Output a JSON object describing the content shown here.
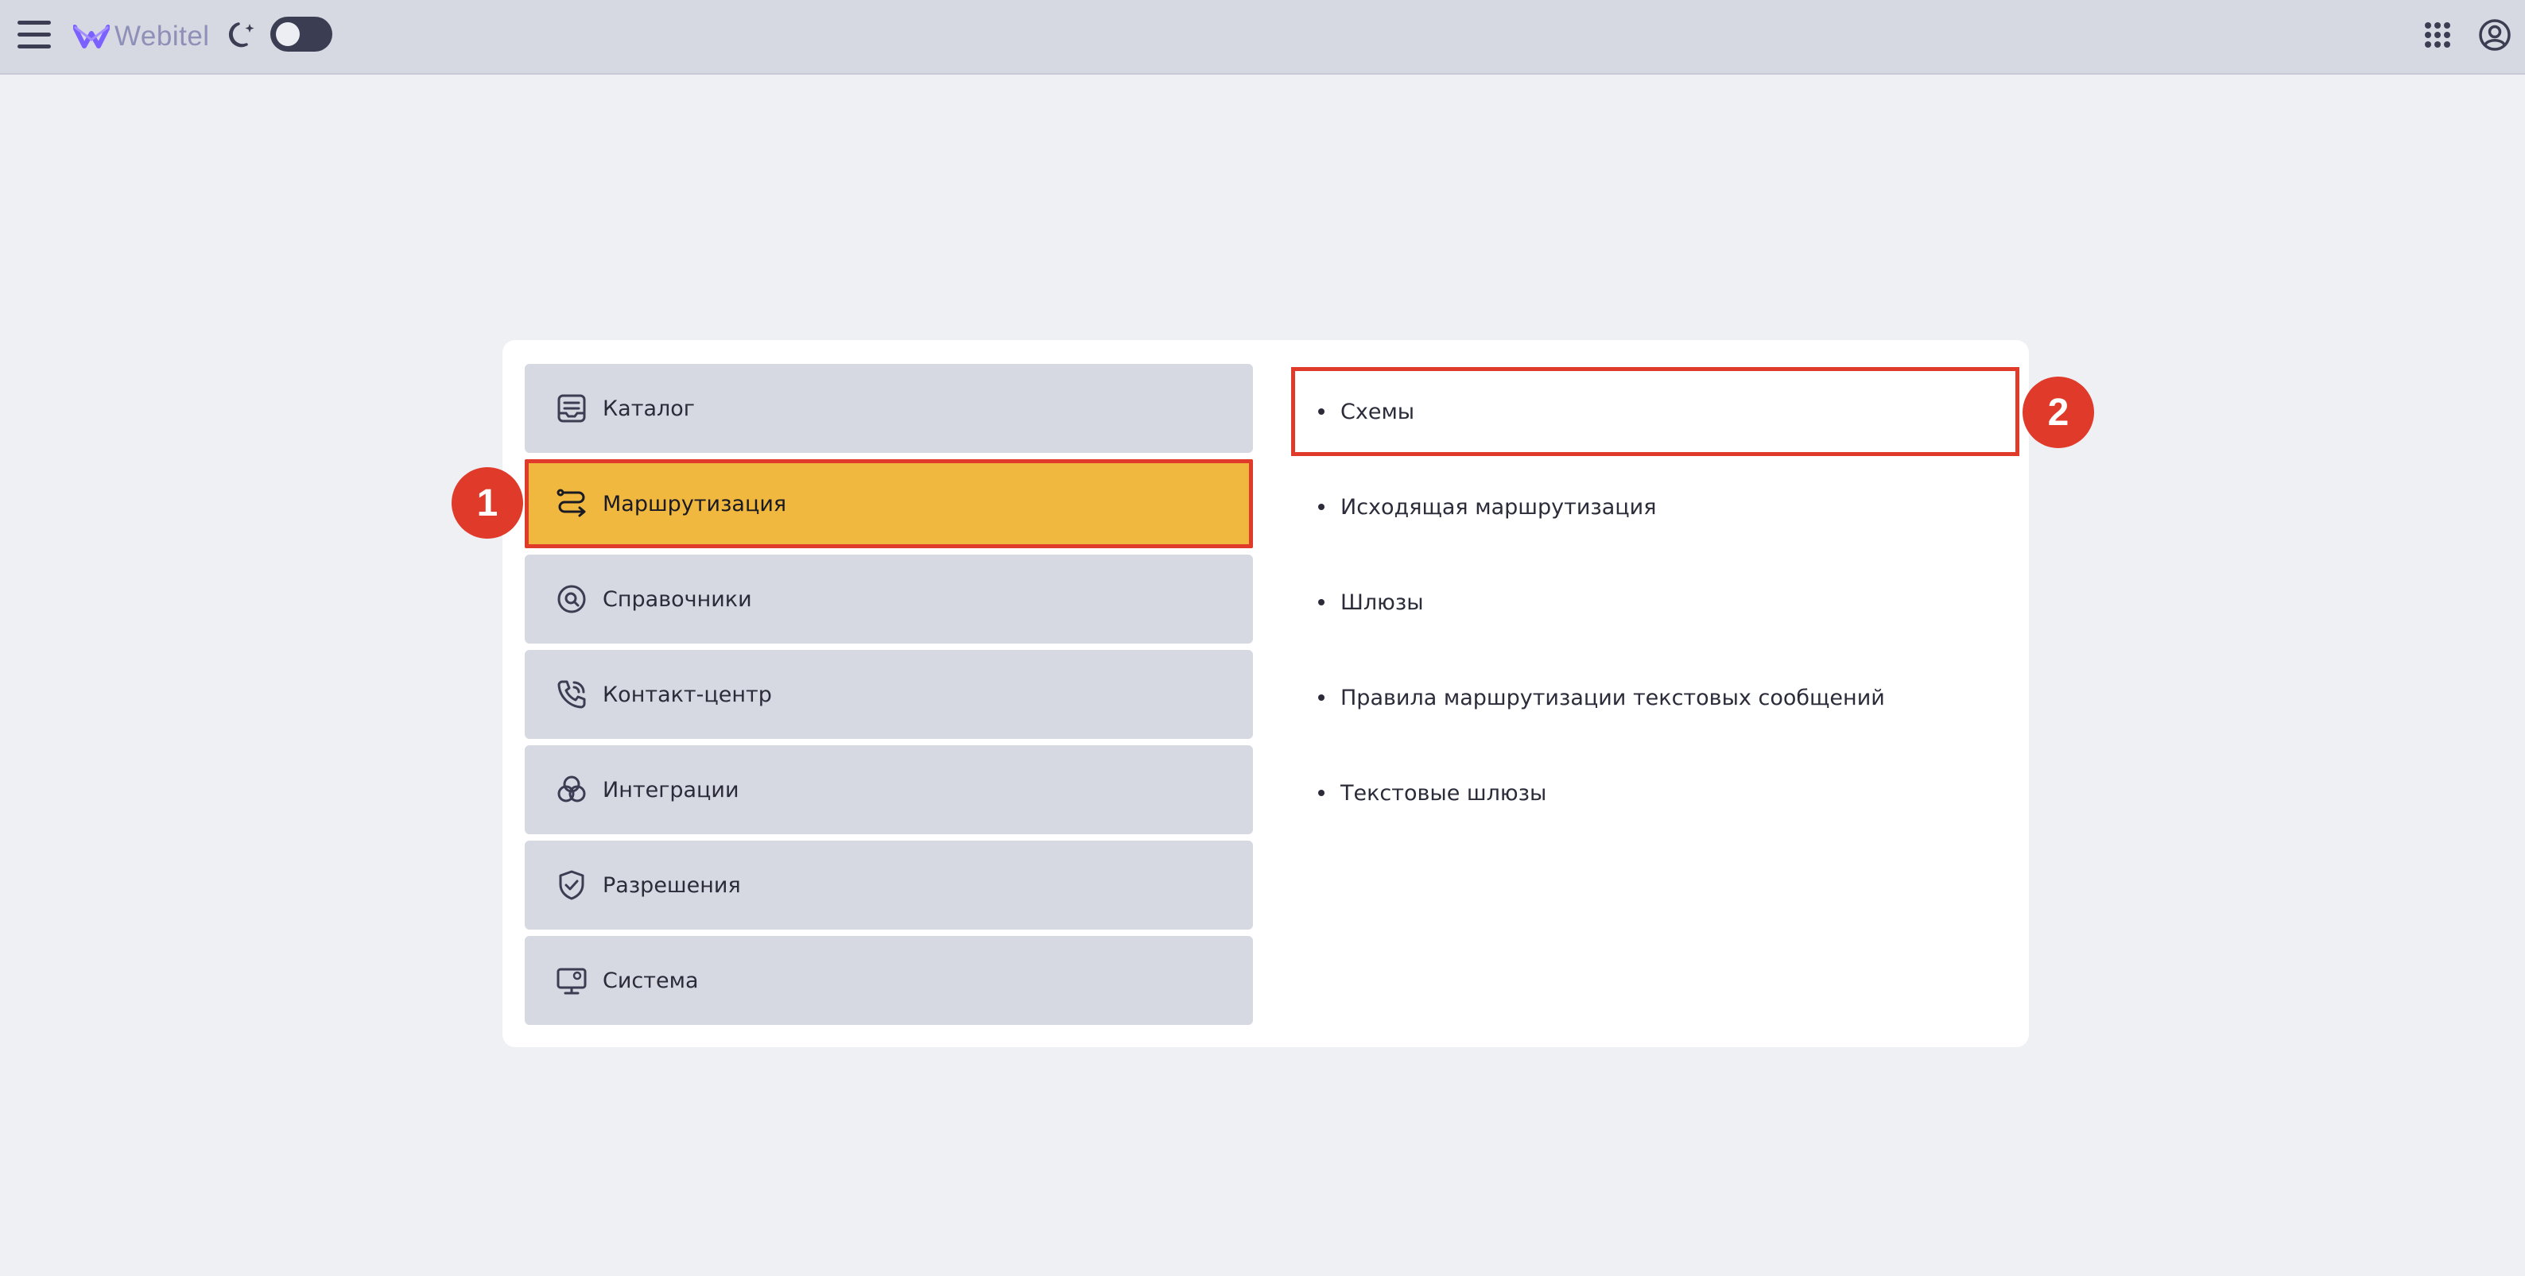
{
  "topbar": {
    "logo_text": "Webitel",
    "brand_color": "#7b61ff",
    "theme_toggle": "off"
  },
  "menu": {
    "items": [
      {
        "label": "Каталог",
        "icon": "catalog-icon"
      },
      {
        "label": "Маршрутизация",
        "icon": "routing-icon",
        "active": true
      },
      {
        "label": "Справочники",
        "icon": "directory-icon"
      },
      {
        "label": "Контакт-центр",
        "icon": "phone-icon"
      },
      {
        "label": "Интеграции",
        "icon": "integrations-icon"
      },
      {
        "label": "Разрешения",
        "icon": "shield-icon"
      },
      {
        "label": "Система",
        "icon": "monitor-icon"
      }
    ]
  },
  "submenu": {
    "items": [
      {
        "label": "Схемы",
        "highlighted": true
      },
      {
        "label": "Исходящая маршрутизация"
      },
      {
        "label": "Шлюзы"
      },
      {
        "label": "Правила маршрутизации текстовых сообщений"
      },
      {
        "label": "Текстовые шлюзы"
      }
    ]
  },
  "annotations": {
    "step1": "1",
    "step2": "2"
  },
  "colors": {
    "active_bg": "#f1b840",
    "highlight_border": "#e03a2a",
    "menu_bg": "#d6d8e2",
    "page_bg": "#eff0f4"
  }
}
